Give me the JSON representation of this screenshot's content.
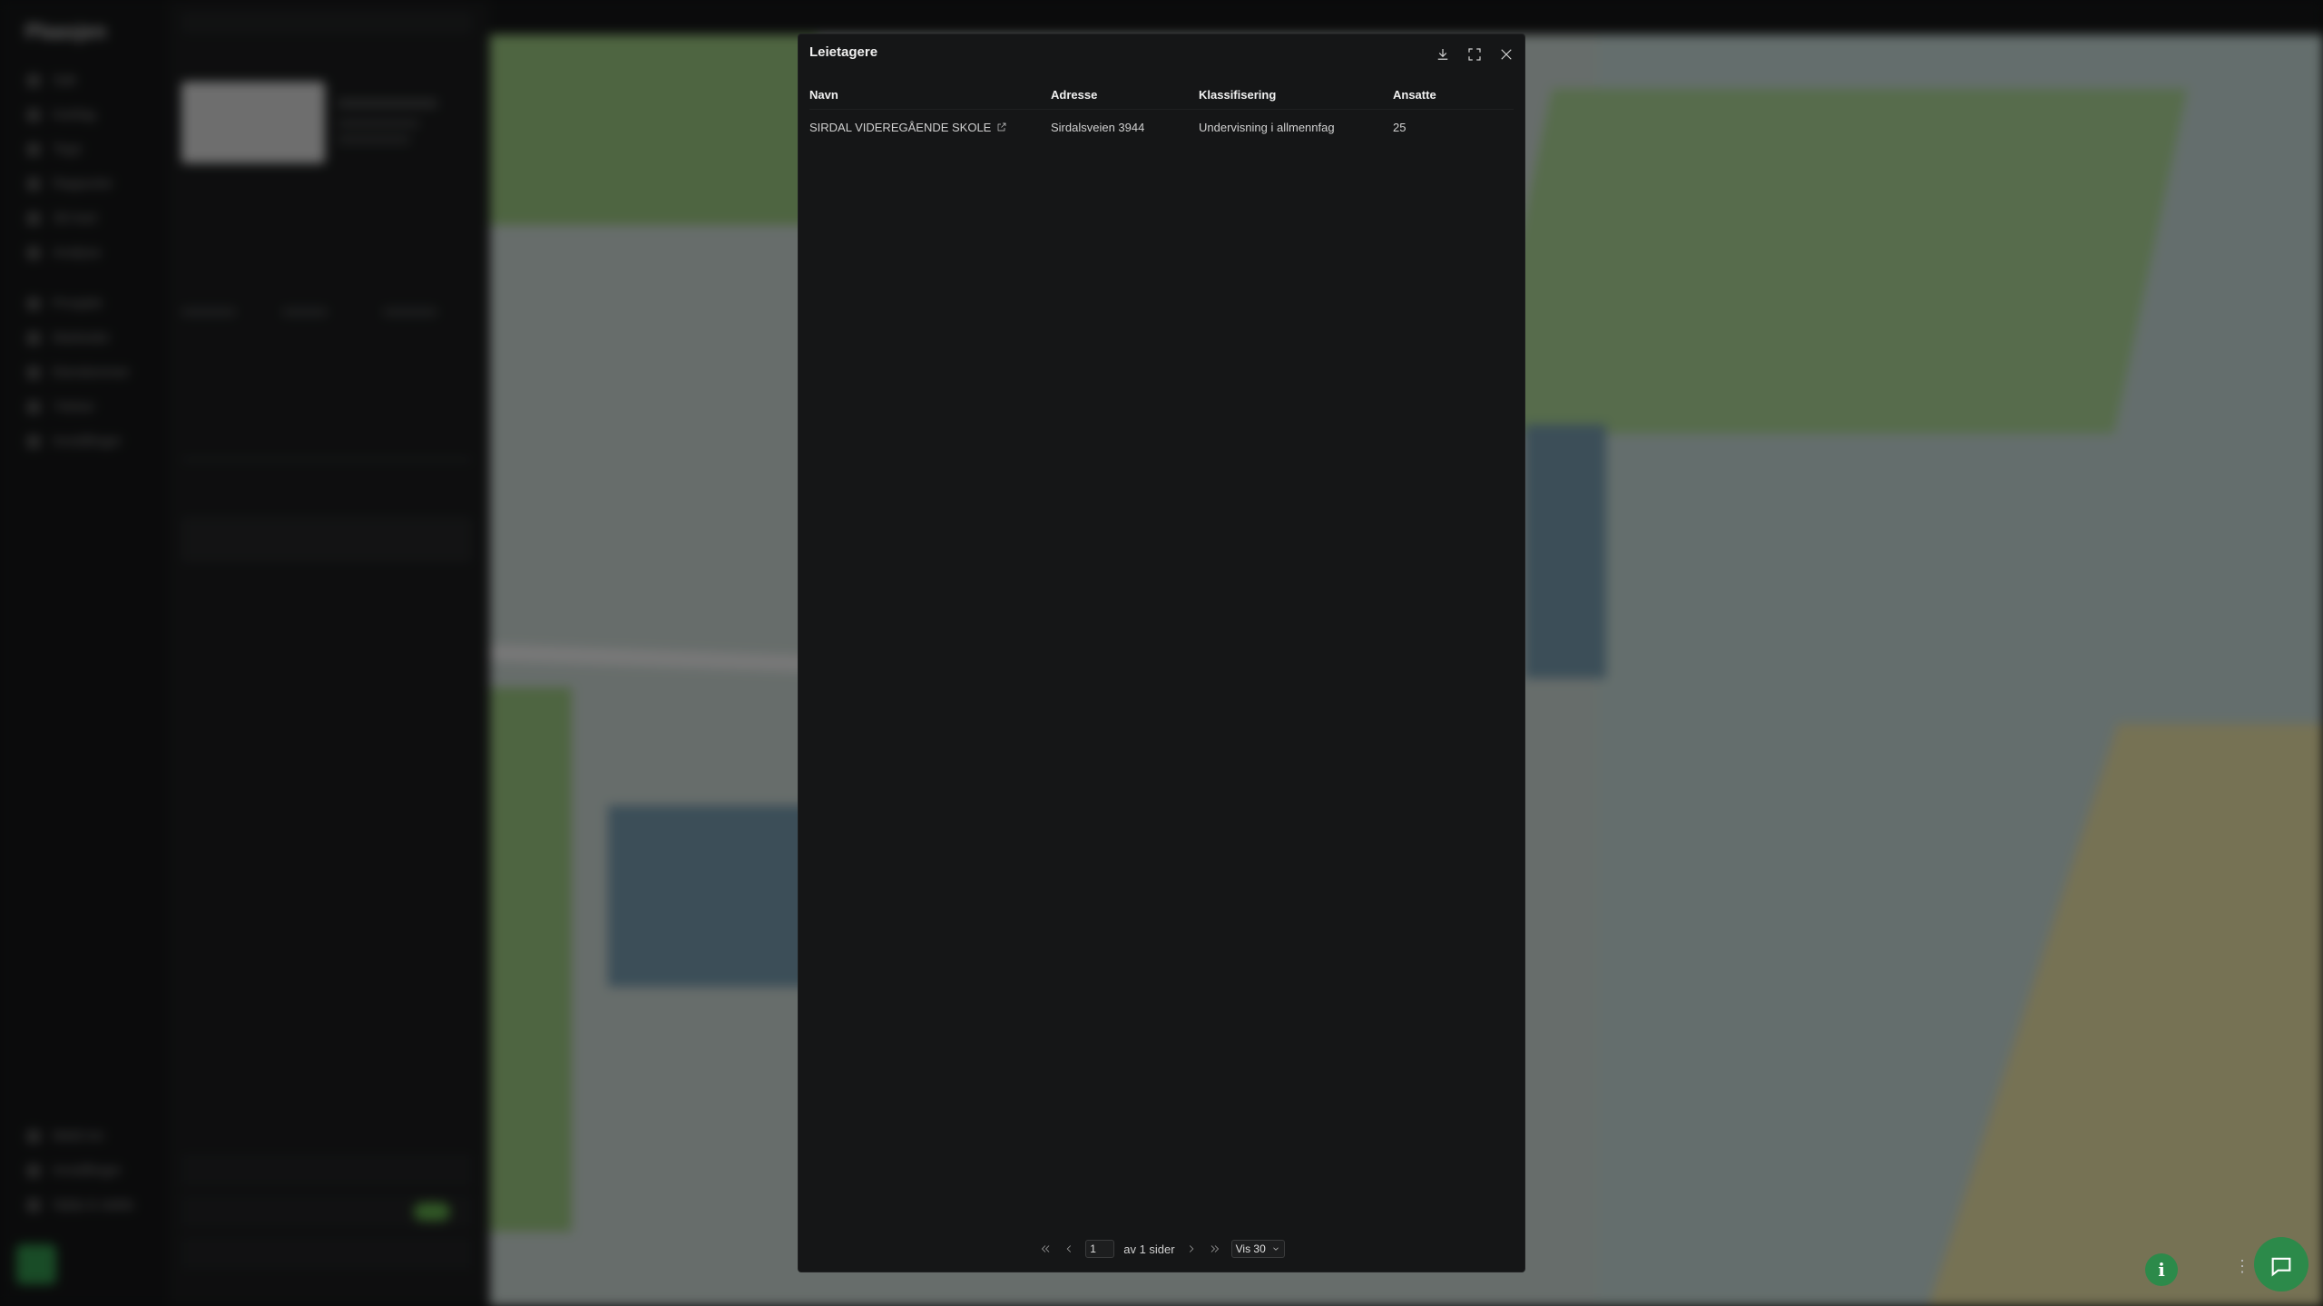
{
  "app": {
    "sidebar_logo": "Plaasjen",
    "sidebar_items": [
      "Søk",
      "Kartlag",
      "Tegn",
      "Rapporter",
      "3D-kart",
      "Analyse",
      "Prosjekt",
      "Markeder",
      "Eiendommer",
      "Ytelser",
      "Innstillinger"
    ],
    "bottom_items": [
      "Meld inn",
      "Innstillinger",
      "Hjelp & støtte"
    ]
  },
  "modal": {
    "title": "Leietagere",
    "columns": [
      "Navn",
      "Adresse",
      "Klassifisering",
      "Ansatte"
    ],
    "rows": [
      {
        "name": "SIRDAL VIDEREGÅENDE SKOLE",
        "address": "Sirdalsveien 3944",
        "classification": "Undervisning i allmennfag",
        "employees": "25"
      }
    ],
    "pagination": {
      "current_page": "1",
      "of_pages_text": "av 1 sider",
      "per_page_label": "Vis 30"
    },
    "icons": {
      "download": "download-icon",
      "expand": "expand-icon",
      "close": "close-icon",
      "external": "external-link-icon"
    }
  },
  "floating": {
    "info_glyph": "i"
  }
}
